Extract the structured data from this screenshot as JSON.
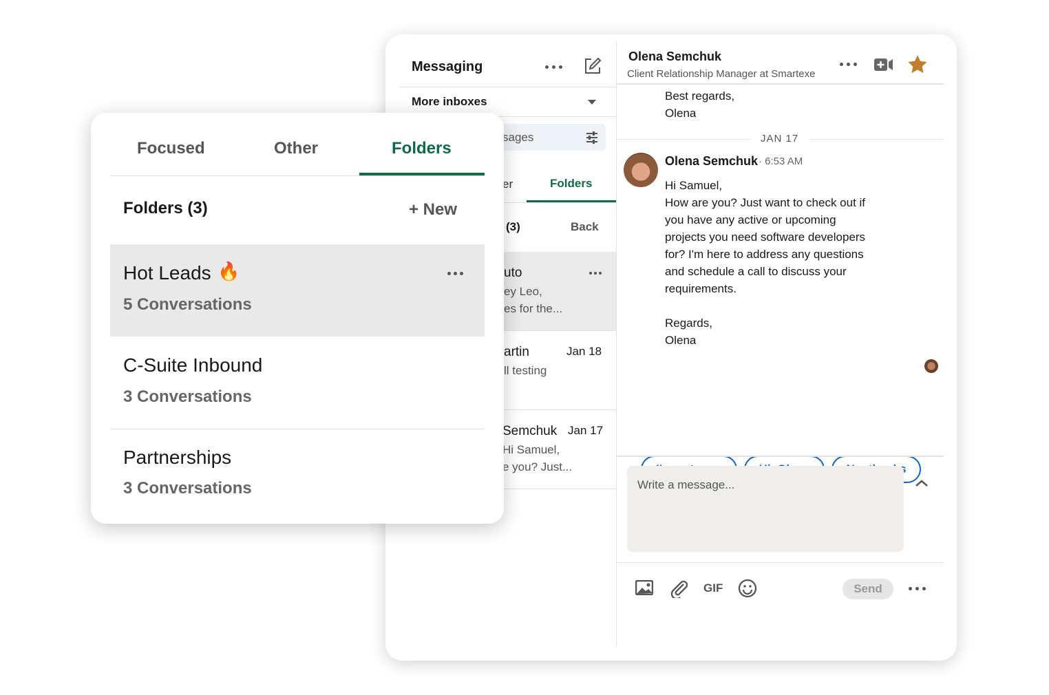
{
  "messaging": {
    "title": "Messaging",
    "more_inboxes": "More inboxes",
    "search_fragment": "sages",
    "tab_other_fragment": "er",
    "tab_folders": "Folders",
    "folders_count_fragment": "(3)",
    "back": "Back",
    "conversations": [
      {
        "name": "uto",
        "line1": "ey Leo,",
        "line2": "es for the...",
        "date": "",
        "selected": true
      },
      {
        "name": "artin",
        "line1": "ll testing",
        "line2": "",
        "date": "Jan 18",
        "selected": false
      },
      {
        "name": "Semchuk",
        "line1": "Hi Samuel,",
        "line2": "e you? Just...",
        "date": "Jan 17",
        "selected": false
      }
    ]
  },
  "thread": {
    "contact_name": "Olena Semchuk",
    "contact_title": "Client Relationship Manager at Smartexe",
    "prev_lines": [
      "Best regards,",
      "Olena"
    ],
    "date_divider": "JAN 17",
    "sender": "Olena Semchuk",
    "time": "· 6:53 AM",
    "body": [
      "Hi Samuel,",
      "How are you? Just want to check out if",
      "you have any active or upcoming",
      "projects you need software developers",
      "for? I'm here to address any questions",
      "and schedule a call to discuss your",
      "requirements.",
      "",
      "Regards,",
      "Olena"
    ],
    "quick_replies": [
      "I'm not sure",
      "Hi, Olena",
      "No, thanks"
    ],
    "compose_placeholder": "Write a message...",
    "gif": "GIF",
    "send": "Send",
    "star_color": "#c37d2b",
    "accent": "#0a66c2"
  },
  "folders_panel": {
    "tabs": [
      "Focused",
      "Other",
      "Folders"
    ],
    "active_tab": "Folders",
    "accent": "#0f6b47",
    "header": "Folders (3)",
    "new_label": "+ New",
    "folders": [
      {
        "name": "Hot Leads",
        "emoji": "🔥",
        "count": "5 Conversations",
        "selected": true
      },
      {
        "name": "C-Suite Inbound",
        "emoji": "",
        "count": "3 Conversations",
        "selected": false
      },
      {
        "name": "Partnerships",
        "emoji": "",
        "count": "3 Conversations",
        "selected": false
      }
    ]
  }
}
